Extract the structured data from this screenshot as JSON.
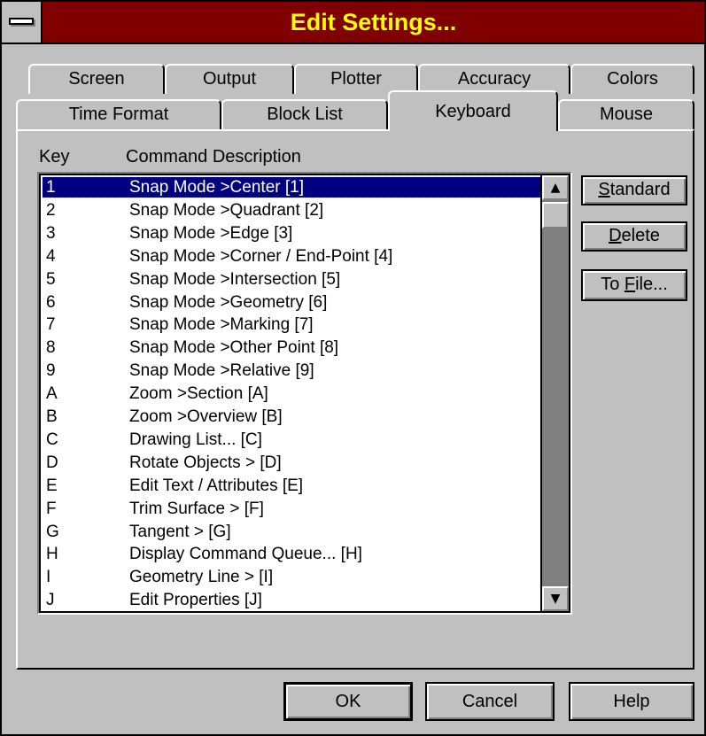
{
  "window": {
    "title": "Edit Settings..."
  },
  "tabs_back": [
    "Screen",
    "Output",
    "Plotter",
    "Accuracy",
    "Colors"
  ],
  "tabs_front": [
    "Time Format",
    "Block List",
    "Keyboard",
    "Mouse"
  ],
  "active_tab": "Keyboard",
  "list": {
    "col_key": "Key",
    "col_desc": "Command Description",
    "rows": [
      {
        "key": "1",
        "desc": "Snap Mode >Center [1]"
      },
      {
        "key": "2",
        "desc": "Snap Mode >Quadrant [2]"
      },
      {
        "key": "3",
        "desc": "Snap Mode >Edge [3]"
      },
      {
        "key": "4",
        "desc": "Snap Mode >Corner / End-Point [4]"
      },
      {
        "key": "5",
        "desc": "Snap Mode >Intersection [5]"
      },
      {
        "key": "6",
        "desc": "Snap Mode >Geometry [6]"
      },
      {
        "key": "7",
        "desc": "Snap Mode >Marking [7]"
      },
      {
        "key": "8",
        "desc": "Snap Mode >Other Point [8]"
      },
      {
        "key": "9",
        "desc": "Snap Mode >Relative [9]"
      },
      {
        "key": "A",
        "desc": "Zoom >Section [A]"
      },
      {
        "key": "B",
        "desc": "Zoom >Overview [B]"
      },
      {
        "key": "C",
        "desc": "Drawing List... [C]"
      },
      {
        "key": "D",
        "desc": "Rotate Objects > [D]"
      },
      {
        "key": "E",
        "desc": "Edit Text / Attributes [E]"
      },
      {
        "key": "F",
        "desc": "Trim Surface > [F]"
      },
      {
        "key": "G",
        "desc": "Tangent > [G]"
      },
      {
        "key": "H",
        "desc": "Display Command Queue... [H]"
      },
      {
        "key": "I",
        "desc": "Geometry Line > [I]"
      },
      {
        "key": "J",
        "desc": "Edit Properties [J]"
      }
    ],
    "selected_index": 0
  },
  "side_buttons": {
    "standard": {
      "accel": "S",
      "rest": "tandard"
    },
    "delete": {
      "accel": "D",
      "rest": "elete"
    },
    "tofile": {
      "pre": "To ",
      "accel": "F",
      "rest": "ile..."
    }
  },
  "footer": {
    "ok": "OK",
    "cancel": "Cancel",
    "help": "Help"
  },
  "icons": {
    "scroll_up": "▲",
    "scroll_down": "▼"
  },
  "colors": {
    "titlebar": "#800000",
    "title_text": "#ffff00",
    "selection": "#000080",
    "face": "#c0c0c0"
  }
}
